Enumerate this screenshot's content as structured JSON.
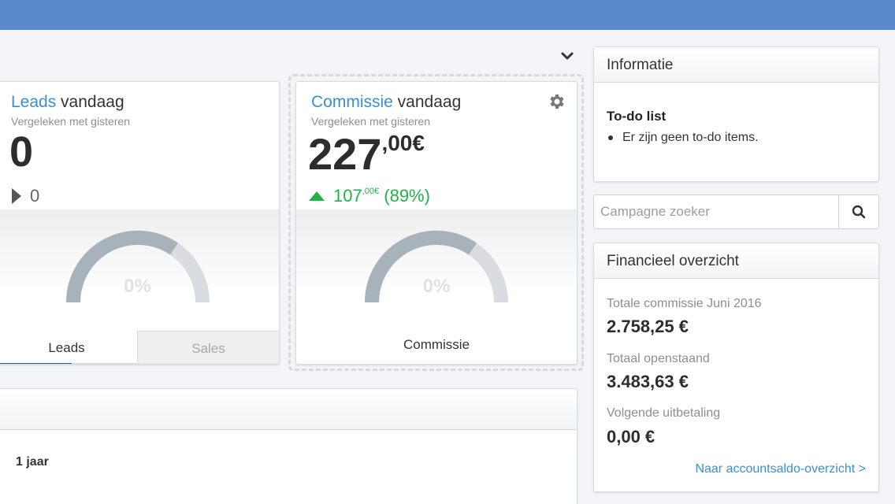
{
  "colors": {
    "header": "#5a89cc",
    "accent": "#3b8fd0",
    "positive": "#22b04b",
    "gauge_fill": "#a8b2ba",
    "gauge_track": "#d9dde2"
  },
  "leads_card": {
    "title_accent": "Leads",
    "title_rest": " vandaag",
    "subtitle": "Vergeleken met gisteren",
    "value": "0",
    "delta_icon": "caret-right-icon",
    "delta": "0",
    "gauge_label": "0%",
    "gauge_percent": 0,
    "tabs": [
      {
        "label": "Leads",
        "active": true
      },
      {
        "label": "Sales",
        "active": false
      }
    ]
  },
  "commission_card": {
    "title_accent": "Commissie",
    "title_rest": " vandaag",
    "subtitle": "Vergeleken met gisteren",
    "value_int": "227",
    "value_dec": ",00€",
    "delta_icon": "triangle-up-icon",
    "delta_int": "107",
    "delta_dec": ",00€",
    "delta_pct": " (89%)",
    "gauge_label": "0%",
    "gauge_percent": 0,
    "footer_label": "Commissie",
    "settings_icon": "gear-icon"
  },
  "bottom_panel": {
    "period": "1 jaar"
  },
  "info_panel": {
    "title": "Informatie",
    "todo_title": "To-do list",
    "todo_items": [
      "Er zijn geen to-do items."
    ]
  },
  "search": {
    "placeholder": "Campagne zoeker",
    "value": "",
    "icon": "search-icon"
  },
  "financial_panel": {
    "title": "Financieel overzicht",
    "rows": [
      {
        "label": "Totale commissie Juni 2016",
        "value": "2.758,25 €"
      },
      {
        "label": "Totaal openstaand",
        "value": "3.483,63 €"
      },
      {
        "label": "Volgende uitbetaling",
        "value": "0,00 €"
      }
    ],
    "link": "Naar accountsaldo-overzicht >"
  },
  "collapse_icon": "chevron-down-icon"
}
